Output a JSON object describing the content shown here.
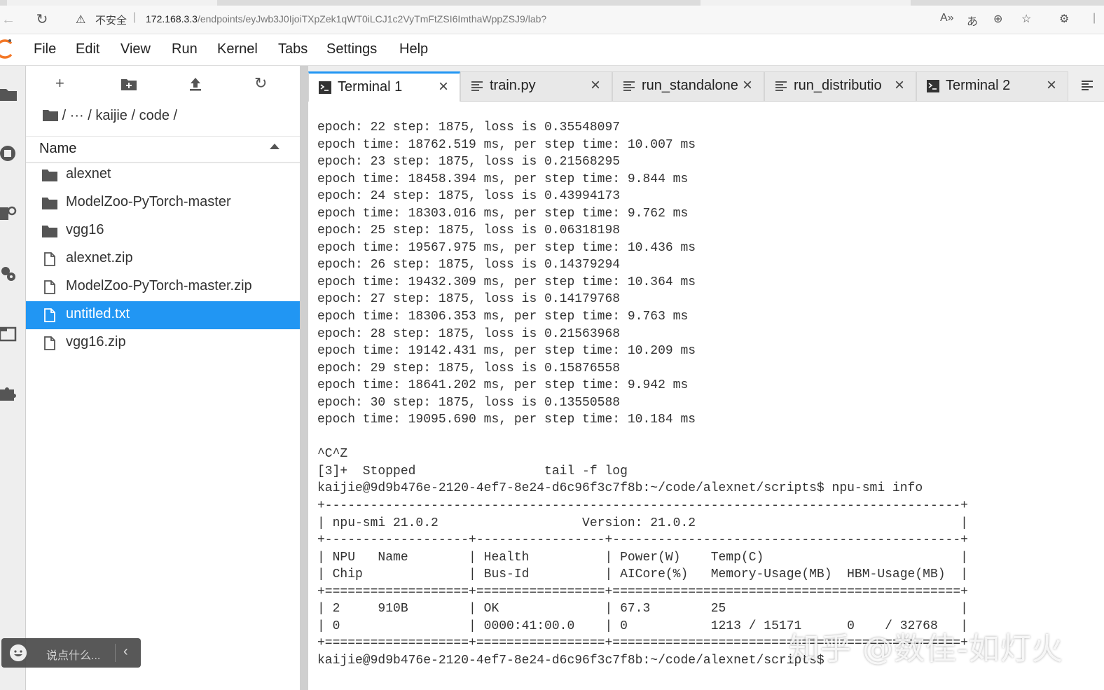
{
  "browser": {
    "insecure_label": "不安全",
    "url_host": "172.168.3.3",
    "url_path": "/endpoints/eyJwb3J0IjoiTXpZek1qWT0iLCJ1c2VyTmFtZSI6ImthaWppZSJ9/lab?"
  },
  "menu": {
    "file": "File",
    "edit": "Edit",
    "view": "View",
    "run": "Run",
    "kernel": "Kernel",
    "tabs": "Tabs",
    "settings": "Settings",
    "help": "Help"
  },
  "filebrowser": {
    "breadcrumb": "/  ···  / kaijie / code /",
    "column_name": "Name",
    "items": [
      {
        "name": "alexnet",
        "type": "folder"
      },
      {
        "name": "ModelZoo-PyTorch-master",
        "type": "folder"
      },
      {
        "name": "vgg16",
        "type": "folder"
      },
      {
        "name": "alexnet.zip",
        "type": "file"
      },
      {
        "name": "ModelZoo-PyTorch-master.zip",
        "type": "file"
      },
      {
        "name": "untitled.txt",
        "type": "file",
        "selected": true
      },
      {
        "name": "vgg16.zip",
        "type": "file"
      }
    ]
  },
  "tabs": [
    {
      "label": "Terminal 1",
      "icon": "terminal-icon",
      "active": true
    },
    {
      "label": "train.py",
      "icon": "text-file-icon"
    },
    {
      "label": "run_standalone",
      "icon": "text-file-icon"
    },
    {
      "label": "run_distributio",
      "icon": "text-file-icon"
    },
    {
      "label": "Terminal 2",
      "icon": "terminal-icon"
    }
  ],
  "terminal": {
    "output": "epoch: 22 step: 1875, loss is 0.35548097\nepoch time: 18762.519 ms, per step time: 10.007 ms\nepoch: 23 step: 1875, loss is 0.21568295\nepoch time: 18458.394 ms, per step time: 9.844 ms\nepoch: 24 step: 1875, loss is 0.43994173\nepoch time: 18303.016 ms, per step time: 9.762 ms\nepoch: 25 step: 1875, loss is 0.06318198\nepoch time: 19567.975 ms, per step time: 10.436 ms\nepoch: 26 step: 1875, loss is 0.14379294\nepoch time: 19432.309 ms, per step time: 10.364 ms\nepoch: 27 step: 1875, loss is 0.14179768\nepoch time: 18306.353 ms, per step time: 9.763 ms\nepoch: 28 step: 1875, loss is 0.21563968\nepoch time: 19142.431 ms, per step time: 10.209 ms\nepoch: 29 step: 1875, loss is 0.15876558\nepoch time: 18641.202 ms, per step time: 9.942 ms\nepoch: 30 step: 1875, loss is 0.13550588\nepoch time: 19095.690 ms, per step time: 10.184 ms\n\n^C^Z\n[3]+  Stopped                 tail -f log\nkaijie@9d9b476e-2120-4ef7-8e24-d6c96f3c7f8b:~/code/alexnet/scripts$ npu-smi info\n+------------------------------------------------------------------------------------+\n| npu-smi 21.0.2                   Version: 21.0.2                                   |\n+-------------------+-----------------+----------------------------------------------+\n| NPU   Name        | Health          | Power(W)    Temp(C)                          |\n| Chip              | Bus-Id          | AICore(%)   Memory-Usage(MB)  HBM-Usage(MB)  |\n+===================+=================+==============================================+\n| 2     910B        | OK              | 67.3        25                               |\n| 0                 | 0000:41:00.0    | 0           1213 / 15171      0    / 32768   |\n+===================+=================+==============================================+\nkaijie@9d9b476e-2120-4ef7-8e24-d6c96f3c7f8b:~/code/alexnet/scripts$"
  },
  "chat": {
    "placeholder": "说点什么..."
  },
  "watermark": "知乎 @数佳-如灯火",
  "colors": {
    "accent": "#2196f3",
    "logo": "#f37726"
  }
}
